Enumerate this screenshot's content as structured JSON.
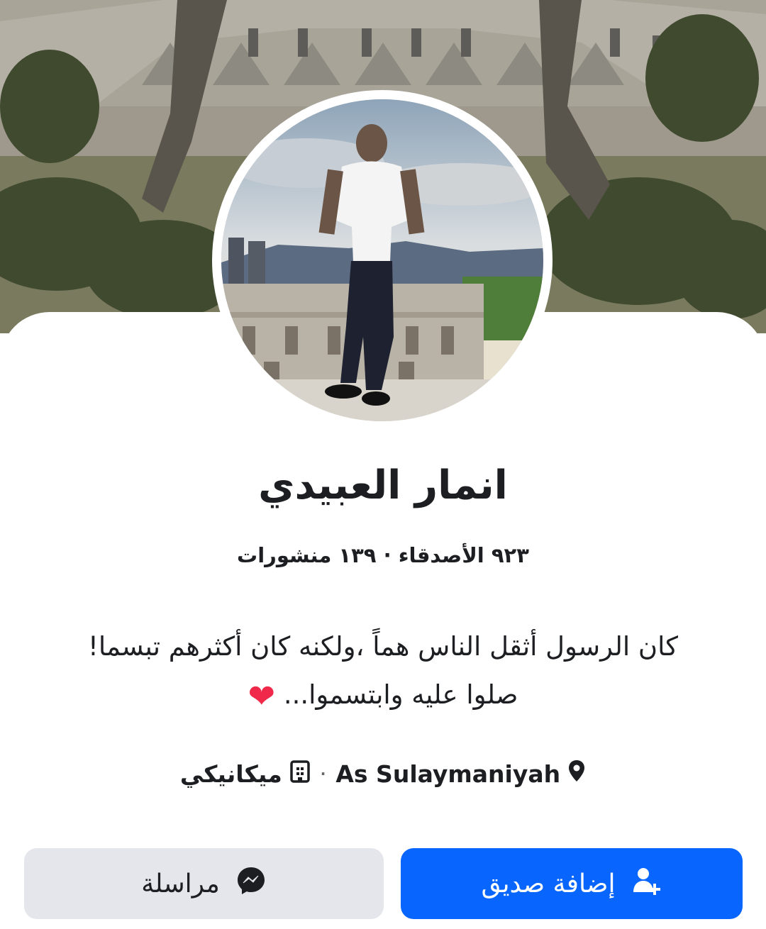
{
  "profile": {
    "name": "انمار العبيدي",
    "stats": "٩٢٣ الأصدقاء · ١٣٩ منشورات",
    "bio_line1": "كان الرسول أثقل الناس هماً ،ولكنه كان أكثرهم تبسما!",
    "bio_line2": "صلوا عليه وابتسموا...",
    "bio_emoji": "❤",
    "location": "As Sulaymaniyah",
    "work": "ميكانيكي",
    "separator": "·"
  },
  "actions": {
    "add_friend_label": "إضافة صديق",
    "message_label": "مراسلة"
  },
  "icons": {
    "location": "map-pin-icon",
    "work": "building-icon",
    "add_friend": "person-add-icon",
    "message": "messenger-icon"
  },
  "colors": {
    "primary": "#0866ff",
    "secondary_button": "#e4e6eb",
    "text": "#1c1e21",
    "heart": "#f0284a"
  }
}
